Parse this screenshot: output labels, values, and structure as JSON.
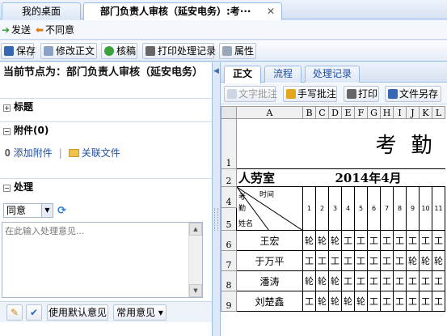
{
  "tabs": [
    {
      "label": "我的桌面"
    },
    {
      "label": "部门负责人审核（延安电务）:考···"
    }
  ],
  "actions": {
    "send": "发送",
    "disagree": "不同意"
  },
  "toolbar": {
    "save": "保存",
    "edit_body": "修改正文",
    "check_draft": "核稿",
    "print_record": "打印处理记录",
    "properties": "属性"
  },
  "left": {
    "node_title": "当前节点为：部门负责人审核（延安电务）",
    "sections": {
      "title": "标题",
      "attachment": "附件(0)",
      "process": "处理"
    },
    "add_attachment": "添加附件",
    "related_file": "关联文件",
    "decision_value": "同意",
    "opinion_placeholder": "在此输入处理意见...",
    "use_default": "使用默认意见",
    "common_opinion": "常用意见"
  },
  "right": {
    "tabs": [
      "正文",
      "流程",
      "处理记录"
    ],
    "tools": {
      "text_signature": "文字批注",
      "handwriting": "手写批注",
      "print": "打印",
      "save_as": "文件另存"
    }
  },
  "sheet": {
    "columns": [
      "A",
      "B",
      "C",
      "D",
      "E",
      "F",
      "G",
      "H",
      "I",
      "J",
      "K",
      "L"
    ],
    "title_char": "考",
    "title_char2": "勤",
    "dept": "人劳室",
    "month": "2014年4月",
    "header_time": "时间",
    "header_kaoqin": "考\n勤",
    "header_name": "姓名",
    "days": [
      "1",
      "2",
      "3",
      "4",
      "5",
      "6",
      "7",
      "8",
      "9",
      "10",
      "11"
    ],
    "row_numbers": [
      "1",
      "2",
      "4",
      "5",
      "6",
      "7",
      "8",
      "9"
    ],
    "rows": [
      {
        "name": "王宏",
        "cells": [
          "轮",
          "轮",
          "轮",
          "工",
          "工",
          "工",
          "工",
          "工",
          "工",
          "工",
          "工"
        ]
      },
      {
        "name": "于万平",
        "cells": [
          "工",
          "工",
          "工",
          "工",
          "工",
          "工",
          "工",
          "工",
          "轮",
          "轮",
          "轮"
        ]
      },
      {
        "name": "潘涛",
        "cells": [
          "轮",
          "轮",
          "轮",
          "工",
          "工",
          "工",
          "工",
          "工",
          "工",
          "工",
          "工"
        ]
      },
      {
        "name": "刘楚鑫",
        "cells": [
          "工",
          "轮",
          "轮",
          "轮",
          "轮",
          "工",
          "工",
          "工",
          "工",
          "工",
          "工"
        ]
      }
    ]
  }
}
